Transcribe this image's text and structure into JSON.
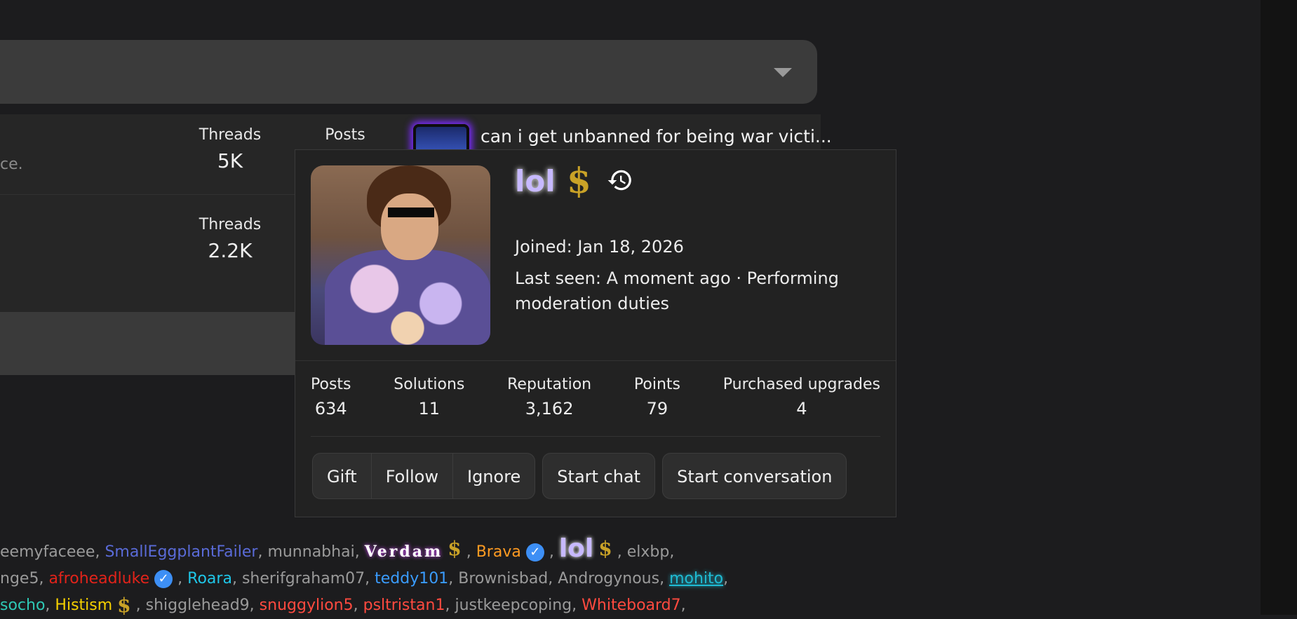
{
  "forum": {
    "rows": [
      {
        "desc_snippet": "ce.",
        "threads_label": "Threads",
        "threads_value": "5K",
        "posts_label": "Posts",
        "latest_title": "can i get unbanned for being war victi..."
      },
      {
        "threads_label": "Threads",
        "threads_value": "2.2K"
      }
    ]
  },
  "profile_card": {
    "badge_text": "lol",
    "icons": [
      "dollar-icon",
      "history-icon"
    ],
    "joined": "Joined: Jan 18, 2026",
    "last_seen": "Last seen: A moment ago · Performing moderation duties",
    "stats": [
      {
        "label": "Posts",
        "value": "634"
      },
      {
        "label": "Solutions",
        "value": "11"
      },
      {
        "label": "Reputation",
        "value": "3,162"
      },
      {
        "label": "Points",
        "value": "79"
      },
      {
        "label": "Purchased upgrades",
        "value": "4"
      }
    ],
    "buttons": {
      "gift": "Gift",
      "follow": "Follow",
      "ignore": "Ignore",
      "start_chat": "Start chat",
      "start_conversation": "Start conversation"
    }
  },
  "online_users": {
    "line1": [
      "eemyfaceee",
      "SmallEggplantFailer",
      "munnabhai",
      "Verdam",
      "Brava",
      "lol",
      "elxbp"
    ],
    "line2": [
      "nge5",
      "afroheadluke",
      "Roara",
      "sherifgraham07",
      "teddy101",
      "Brownisbad",
      "Androgynous",
      "mohito"
    ],
    "line3": [
      "socho",
      "Histism",
      "shigglehead9",
      "snuggylion5",
      "psltristan1",
      "justkeepcoping",
      "Whiteboard7"
    ]
  },
  "colors": {
    "background": "#1c1c1e",
    "card": "#222222",
    "accent_glow": "#7c2bff",
    "dollar": "#c9a227",
    "verified": "#3d8ff5"
  }
}
